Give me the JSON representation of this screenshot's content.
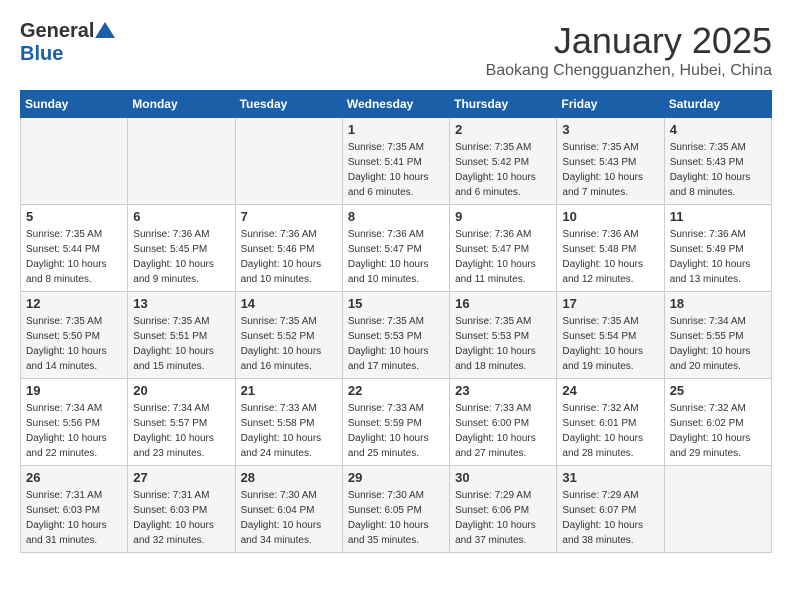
{
  "header": {
    "logo_general": "General",
    "logo_blue": "Blue",
    "title": "January 2025",
    "subtitle": "Baokang Chengguanzhen, Hubei, China"
  },
  "days_of_week": [
    "Sunday",
    "Monday",
    "Tuesday",
    "Wednesday",
    "Thursday",
    "Friday",
    "Saturday"
  ],
  "weeks": [
    {
      "cells": [
        {
          "day": "",
          "info": ""
        },
        {
          "day": "",
          "info": ""
        },
        {
          "day": "",
          "info": ""
        },
        {
          "day": "1",
          "info": "Sunrise: 7:35 AM\nSunset: 5:41 PM\nDaylight: 10 hours\nand 6 minutes."
        },
        {
          "day": "2",
          "info": "Sunrise: 7:35 AM\nSunset: 5:42 PM\nDaylight: 10 hours\nand 6 minutes."
        },
        {
          "day": "3",
          "info": "Sunrise: 7:35 AM\nSunset: 5:43 PM\nDaylight: 10 hours\nand 7 minutes."
        },
        {
          "day": "4",
          "info": "Sunrise: 7:35 AM\nSunset: 5:43 PM\nDaylight: 10 hours\nand 8 minutes."
        }
      ]
    },
    {
      "cells": [
        {
          "day": "5",
          "info": "Sunrise: 7:35 AM\nSunset: 5:44 PM\nDaylight: 10 hours\nand 8 minutes."
        },
        {
          "day": "6",
          "info": "Sunrise: 7:36 AM\nSunset: 5:45 PM\nDaylight: 10 hours\nand 9 minutes."
        },
        {
          "day": "7",
          "info": "Sunrise: 7:36 AM\nSunset: 5:46 PM\nDaylight: 10 hours\nand 10 minutes."
        },
        {
          "day": "8",
          "info": "Sunrise: 7:36 AM\nSunset: 5:47 PM\nDaylight: 10 hours\nand 10 minutes."
        },
        {
          "day": "9",
          "info": "Sunrise: 7:36 AM\nSunset: 5:47 PM\nDaylight: 10 hours\nand 11 minutes."
        },
        {
          "day": "10",
          "info": "Sunrise: 7:36 AM\nSunset: 5:48 PM\nDaylight: 10 hours\nand 12 minutes."
        },
        {
          "day": "11",
          "info": "Sunrise: 7:36 AM\nSunset: 5:49 PM\nDaylight: 10 hours\nand 13 minutes."
        }
      ]
    },
    {
      "cells": [
        {
          "day": "12",
          "info": "Sunrise: 7:35 AM\nSunset: 5:50 PM\nDaylight: 10 hours\nand 14 minutes."
        },
        {
          "day": "13",
          "info": "Sunrise: 7:35 AM\nSunset: 5:51 PM\nDaylight: 10 hours\nand 15 minutes."
        },
        {
          "day": "14",
          "info": "Sunrise: 7:35 AM\nSunset: 5:52 PM\nDaylight: 10 hours\nand 16 minutes."
        },
        {
          "day": "15",
          "info": "Sunrise: 7:35 AM\nSunset: 5:53 PM\nDaylight: 10 hours\nand 17 minutes."
        },
        {
          "day": "16",
          "info": "Sunrise: 7:35 AM\nSunset: 5:53 PM\nDaylight: 10 hours\nand 18 minutes."
        },
        {
          "day": "17",
          "info": "Sunrise: 7:35 AM\nSunset: 5:54 PM\nDaylight: 10 hours\nand 19 minutes."
        },
        {
          "day": "18",
          "info": "Sunrise: 7:34 AM\nSunset: 5:55 PM\nDaylight: 10 hours\nand 20 minutes."
        }
      ]
    },
    {
      "cells": [
        {
          "day": "19",
          "info": "Sunrise: 7:34 AM\nSunset: 5:56 PM\nDaylight: 10 hours\nand 22 minutes."
        },
        {
          "day": "20",
          "info": "Sunrise: 7:34 AM\nSunset: 5:57 PM\nDaylight: 10 hours\nand 23 minutes."
        },
        {
          "day": "21",
          "info": "Sunrise: 7:33 AM\nSunset: 5:58 PM\nDaylight: 10 hours\nand 24 minutes."
        },
        {
          "day": "22",
          "info": "Sunrise: 7:33 AM\nSunset: 5:59 PM\nDaylight: 10 hours\nand 25 minutes."
        },
        {
          "day": "23",
          "info": "Sunrise: 7:33 AM\nSunset: 6:00 PM\nDaylight: 10 hours\nand 27 minutes."
        },
        {
          "day": "24",
          "info": "Sunrise: 7:32 AM\nSunset: 6:01 PM\nDaylight: 10 hours\nand 28 minutes."
        },
        {
          "day": "25",
          "info": "Sunrise: 7:32 AM\nSunset: 6:02 PM\nDaylight: 10 hours\nand 29 minutes."
        }
      ]
    },
    {
      "cells": [
        {
          "day": "26",
          "info": "Sunrise: 7:31 AM\nSunset: 6:03 PM\nDaylight: 10 hours\nand 31 minutes."
        },
        {
          "day": "27",
          "info": "Sunrise: 7:31 AM\nSunset: 6:03 PM\nDaylight: 10 hours\nand 32 minutes."
        },
        {
          "day": "28",
          "info": "Sunrise: 7:30 AM\nSunset: 6:04 PM\nDaylight: 10 hours\nand 34 minutes."
        },
        {
          "day": "29",
          "info": "Sunrise: 7:30 AM\nSunset: 6:05 PM\nDaylight: 10 hours\nand 35 minutes."
        },
        {
          "day": "30",
          "info": "Sunrise: 7:29 AM\nSunset: 6:06 PM\nDaylight: 10 hours\nand 37 minutes."
        },
        {
          "day": "31",
          "info": "Sunrise: 7:29 AM\nSunset: 6:07 PM\nDaylight: 10 hours\nand 38 minutes."
        },
        {
          "day": "",
          "info": ""
        }
      ]
    }
  ]
}
